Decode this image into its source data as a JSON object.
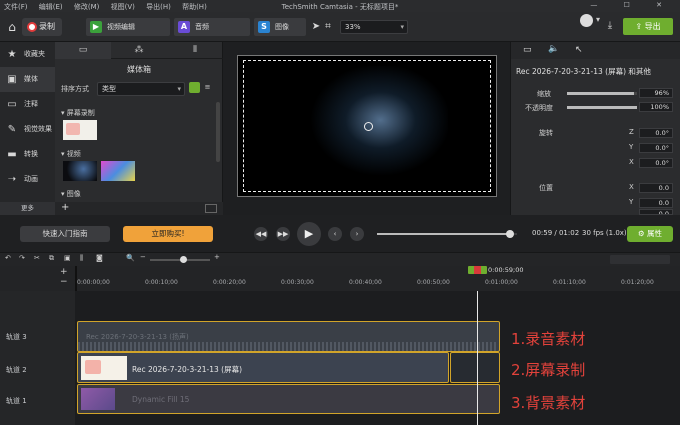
{
  "app": {
    "title": "TechSmith Camtasia - 无标题项目*",
    "menu": [
      "文件(F)",
      "编辑(E)",
      "修改(M)",
      "视图(V)",
      "导出(H)",
      "帮助(H)"
    ],
    "window_controls": "— ☐ ✕"
  },
  "toolbar": {
    "record_label": "录制",
    "tabs": [
      {
        "label": "视频编辑",
        "icon": "film-icon",
        "color": "#3ba13b"
      },
      {
        "label": "音频",
        "icon": "audio-icon",
        "color": "#6a4cd6"
      },
      {
        "label": "图像",
        "icon": "image-icon",
        "color": "#2a83d1"
      }
    ],
    "zoom": "33%",
    "export_label": "导出"
  },
  "leftnav": {
    "items": [
      {
        "label": "收藏夹",
        "icon": "star-icon"
      },
      {
        "label": "媒体",
        "icon": "media-icon"
      },
      {
        "label": "注释",
        "icon": "annotation-icon"
      },
      {
        "label": "视觉效果",
        "icon": "wand-icon"
      },
      {
        "label": "转换",
        "icon": "transition-icon"
      },
      {
        "label": "动画",
        "icon": "animation-icon"
      }
    ],
    "more_label": "更多"
  },
  "bin": {
    "title": "媒体箱",
    "sort_label": "排序方式",
    "sort_value": "类型",
    "sections": [
      "屏幕录制",
      "视频",
      "图像"
    ]
  },
  "props": {
    "clip_title": "Rec 2026-7-20-3-21-13 (屏幕) 和其他",
    "scale_label": "缩放",
    "scale_value": "96%",
    "opacity_label": "不透明度",
    "opacity_value": "100%",
    "rotation_label": "旋转",
    "rotation": [
      {
        "axis": "Z",
        "value": "0.0°"
      },
      {
        "axis": "Y",
        "value": "0.0°"
      },
      {
        "axis": "X",
        "value": "0.0°"
      }
    ],
    "position_label": "位置",
    "position": [
      {
        "axis": "X",
        "value": "0.0"
      },
      {
        "axis": "Y",
        "value": "0.0"
      },
      {
        "axis": "Z",
        "value": "0.0"
      }
    ],
    "scale_level": 0.96,
    "opacity_level": 1.0
  },
  "playback": {
    "guide_label": "快速入门指南",
    "buy_label": "立即购买!",
    "timecode": "00:59 / 01:02",
    "fps": "30 fps (1.0x)",
    "properties_label": "属性",
    "progress": 0.95
  },
  "timeline": {
    "playhead_time": "0:00:59;00",
    "ticks": [
      "0:00:00;00",
      "0:00:10;00",
      "0:00:20;00",
      "0:00:30;00",
      "0:00:40;00",
      "0:00:50;00",
      "0:01:00;00",
      "0:01:10;00",
      "0:01:20;00"
    ],
    "tracks": [
      {
        "label": "轨道 3",
        "clip": "Rec 2026-7-20-3-21-13 (扬声)",
        "annotation": "1.录音素材"
      },
      {
        "label": "轨道 2",
        "clip": "Rec 2026-7-20-3-21-13 (屏幕)",
        "annotation": "2.屏幕录制"
      },
      {
        "label": "轨道 1",
        "clip": "Dynamic Fill 15",
        "annotation": "3.背景素材"
      }
    ]
  }
}
